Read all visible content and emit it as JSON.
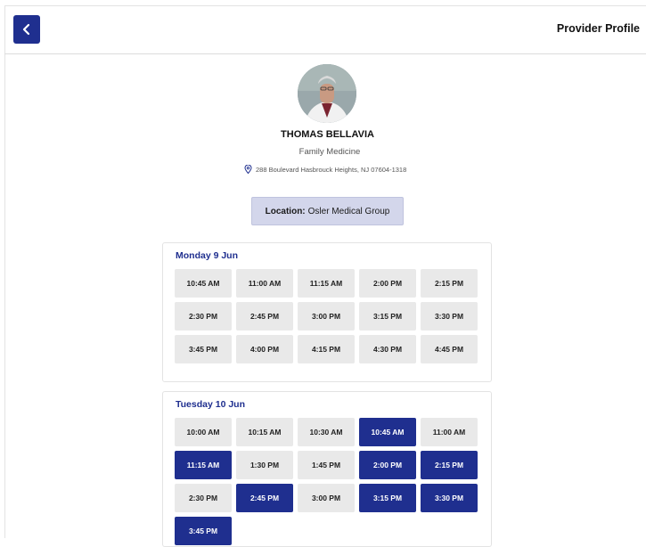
{
  "header": {
    "title": "Provider Profile",
    "back_icon": "chevron-left-icon"
  },
  "provider": {
    "name": "THOMAS BELLAVIA",
    "specialty": "Family Medicine",
    "address": "288 Boulevard Hasbrouck Heights, NJ 07604-1318",
    "address_icon": "location-pin-icon"
  },
  "location": {
    "label": "Location:",
    "value": "Osler Medical Group"
  },
  "colors": {
    "accent": "#1f2f8f",
    "slot_bg": "#e9e9e9",
    "location_bg": "#d3d6eb"
  },
  "days": [
    {
      "title": "Monday 9 Jun",
      "slots": [
        {
          "time": "10:45 AM",
          "selected": false
        },
        {
          "time": "11:00 AM",
          "selected": false
        },
        {
          "time": "11:15 AM",
          "selected": false
        },
        {
          "time": "2:00 PM",
          "selected": false
        },
        {
          "time": "2:15 PM",
          "selected": false
        },
        {
          "time": "2:30 PM",
          "selected": false
        },
        {
          "time": "2:45 PM",
          "selected": false
        },
        {
          "time": "3:00 PM",
          "selected": false
        },
        {
          "time": "3:15 PM",
          "selected": false
        },
        {
          "time": "3:30 PM",
          "selected": false
        },
        {
          "time": "3:45 PM",
          "selected": false
        },
        {
          "time": "4:00 PM",
          "selected": false
        },
        {
          "time": "4:15 PM",
          "selected": false
        },
        {
          "time": "4:30 PM",
          "selected": false
        },
        {
          "time": "4:45 PM",
          "selected": false
        }
      ]
    },
    {
      "title": "Tuesday 10 Jun",
      "slots": [
        {
          "time": "10:00 AM",
          "selected": false
        },
        {
          "time": "10:15 AM",
          "selected": false
        },
        {
          "time": "10:30 AM",
          "selected": false
        },
        {
          "time": "10:45 AM",
          "selected": true
        },
        {
          "time": "11:00 AM",
          "selected": false
        },
        {
          "time": "11:15 AM",
          "selected": true
        },
        {
          "time": "1:30 PM",
          "selected": false
        },
        {
          "time": "1:45 PM",
          "selected": false
        },
        {
          "time": "2:00 PM",
          "selected": true
        },
        {
          "time": "2:15 PM",
          "selected": true
        },
        {
          "time": "2:30 PM",
          "selected": false
        },
        {
          "time": "2:45 PM",
          "selected": true
        },
        {
          "time": "3:00 PM",
          "selected": false
        },
        {
          "time": "3:15 PM",
          "selected": true
        },
        {
          "time": "3:30 PM",
          "selected": true
        },
        {
          "time": "3:45 PM",
          "selected": true
        }
      ]
    }
  ]
}
